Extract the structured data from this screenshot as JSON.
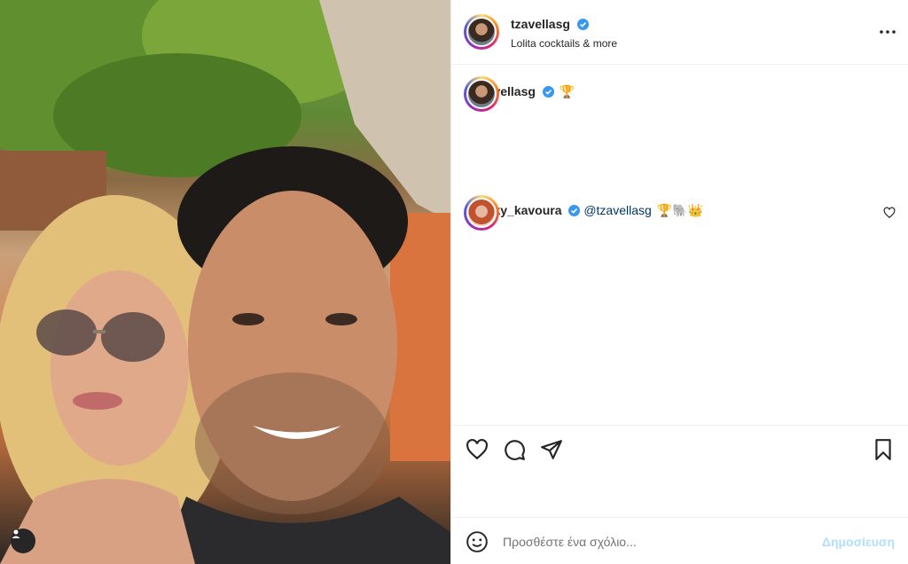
{
  "post": {
    "author": {
      "username": "tzavellasg",
      "location": "Lolita cocktails & more"
    },
    "caption": {
      "username": "tzavellasg",
      "emoji": "🏆"
    },
    "comments": [
      {
        "username": "vicky_kavoura",
        "mention": "@tzavellasg",
        "emojis": "🏆🐘👑"
      }
    ]
  },
  "composer": {
    "placeholder": "Προσθέστε ένα σχόλιο...",
    "post_label": "Δημοσίευση"
  },
  "icons": {
    "verified": "verified-badge-icon",
    "more": "more-options-icon",
    "like": "heart-icon",
    "comment": "comment-icon",
    "share": "send-icon",
    "save": "bookmark-icon",
    "emoji": "emoji-icon",
    "user_tag": "user-tag-icon"
  },
  "colors": {
    "verified": "#3897f0",
    "link": "#00376b",
    "post_button": "#b2dffc",
    "text": "#262626"
  }
}
